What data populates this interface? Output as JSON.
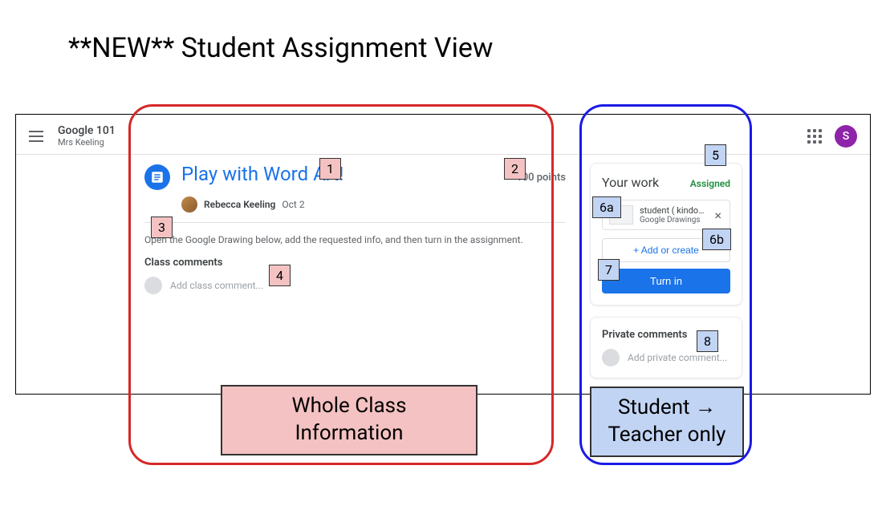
{
  "slide": {
    "title": "**NEW** Student Assignment View"
  },
  "header": {
    "class_name": "Google 101",
    "teacher": "Mrs Keeling",
    "avatar_letter": "S"
  },
  "assignment": {
    "title": "Play with Word Art!",
    "points": "100 points",
    "author": "Rebecca Keeling",
    "date": "Oct 2",
    "description": "Open the Google Drawing below, add the requested info, and then turn in the assignment.",
    "class_comments_header": "Class comments",
    "class_comment_placeholder": "Add class comment..."
  },
  "your_work": {
    "title": "Your work",
    "status": "Assigned",
    "attachment_name": "student ( kindof ) ...",
    "attachment_type": "Google Drawings",
    "add_create_label": "+  Add or create",
    "turn_in_label": "Turn in"
  },
  "private": {
    "title": "Private comments",
    "placeholder": "Add private comment..."
  },
  "annotations": {
    "n1": "1",
    "n2": "2",
    "n3": "3",
    "n4": "4",
    "n5": "5",
    "n6a": "6a",
    "n6b": "6b",
    "n7": "7",
    "n8": "8",
    "region_red": "Whole Class Information",
    "region_blue": "Student → Teacher only"
  }
}
